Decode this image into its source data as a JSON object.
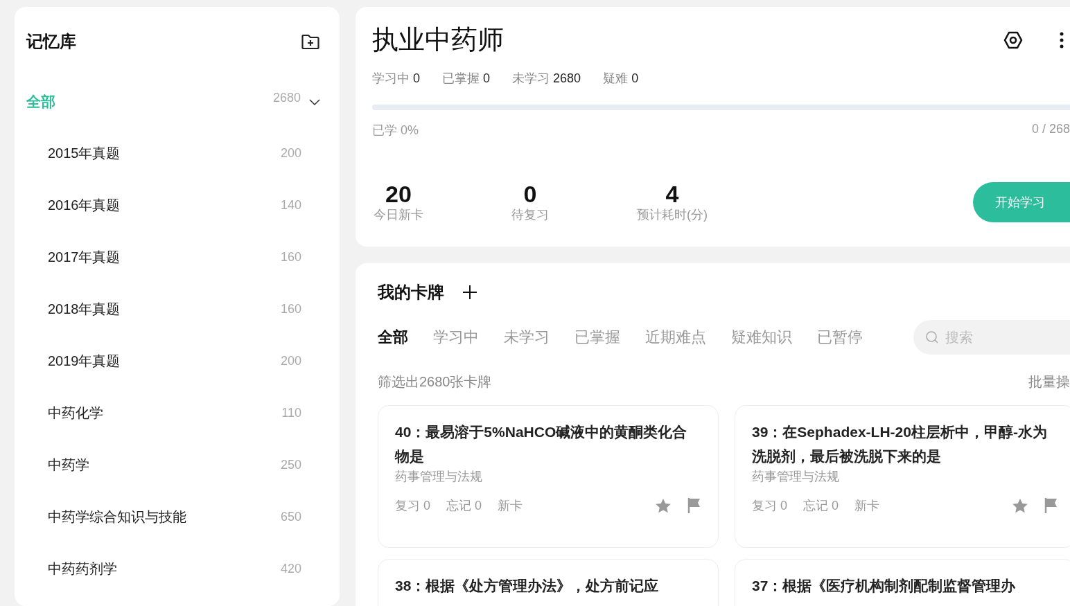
{
  "sidebar": {
    "title": "记忆库",
    "all": {
      "label": "全部",
      "count": "2680",
      "selected": true,
      "expanded": true,
      "children": [
        {
          "label": "2015年真题",
          "count": "200",
          "selected": false
        },
        {
          "label": "2016年真题",
          "count": "140",
          "selected": false
        },
        {
          "label": "2017年真题",
          "count": "160",
          "selected": false
        },
        {
          "label": "2018年真题",
          "count": "160",
          "selected": false
        },
        {
          "label": "2019年真题",
          "count": "200",
          "selected": false
        },
        {
          "label": "中药化学",
          "count": "110",
          "selected": false
        },
        {
          "label": "中药学",
          "count": "250",
          "selected": false
        },
        {
          "label": "中药学综合知识与技能",
          "count": "650",
          "selected": false
        },
        {
          "label": "中药药剂学",
          "count": "420",
          "selected": false
        }
      ]
    }
  },
  "deck": {
    "title": "执业中药师",
    "stats": [
      {
        "label": "学习中",
        "value": "0"
      },
      {
        "label": "已掌握",
        "value": "0"
      },
      {
        "label": "未学习",
        "value": "2680"
      },
      {
        "label": "疑难",
        "value": "0"
      }
    ],
    "progress": {
      "level": 0,
      "label": "已学 0%",
      "count": "0 / 268"
    },
    "summary": [
      {
        "value": "20",
        "label": "今日新卡"
      },
      {
        "value": "0",
        "label": "待复习"
      },
      {
        "value": "4",
        "label": "预计耗时(分)"
      }
    ],
    "start_button": "开始学习"
  },
  "cards_panel": {
    "title": "我的卡牌",
    "tabs": [
      {
        "label": "全部",
        "selected": true
      },
      {
        "label": "学习中",
        "selected": false
      },
      {
        "label": "未学习",
        "selected": false
      },
      {
        "label": "已掌握",
        "selected": false
      },
      {
        "label": "近期难点",
        "selected": false
      },
      {
        "label": "疑难知识",
        "selected": false
      },
      {
        "label": "已暂停",
        "selected": false
      }
    ],
    "search": {
      "placeholder": "搜索"
    },
    "filter_text": "筛选出2680张卡牌",
    "batch": "批量操",
    "cards": [
      {
        "title": "40：最易溶于5%NaHCO碱液中的黄酮类化合物是",
        "category": "药事管理与法规",
        "review": "复习 0",
        "forget": "忘记 0",
        "status": "新卡"
      },
      {
        "title": "39：在Sephadex-LH-20柱层析中，甲醇-水为洗脱剂，最后被洗脱下来的是",
        "category": "药事管理与法规",
        "review": "复习 0",
        "forget": "忘记 0",
        "status": "新卡"
      },
      {
        "title": "38：根据《处方管理办法》，处方前记应"
      },
      {
        "title": "37：根据《医疗机构制剂配制监督管理办"
      }
    ]
  }
}
